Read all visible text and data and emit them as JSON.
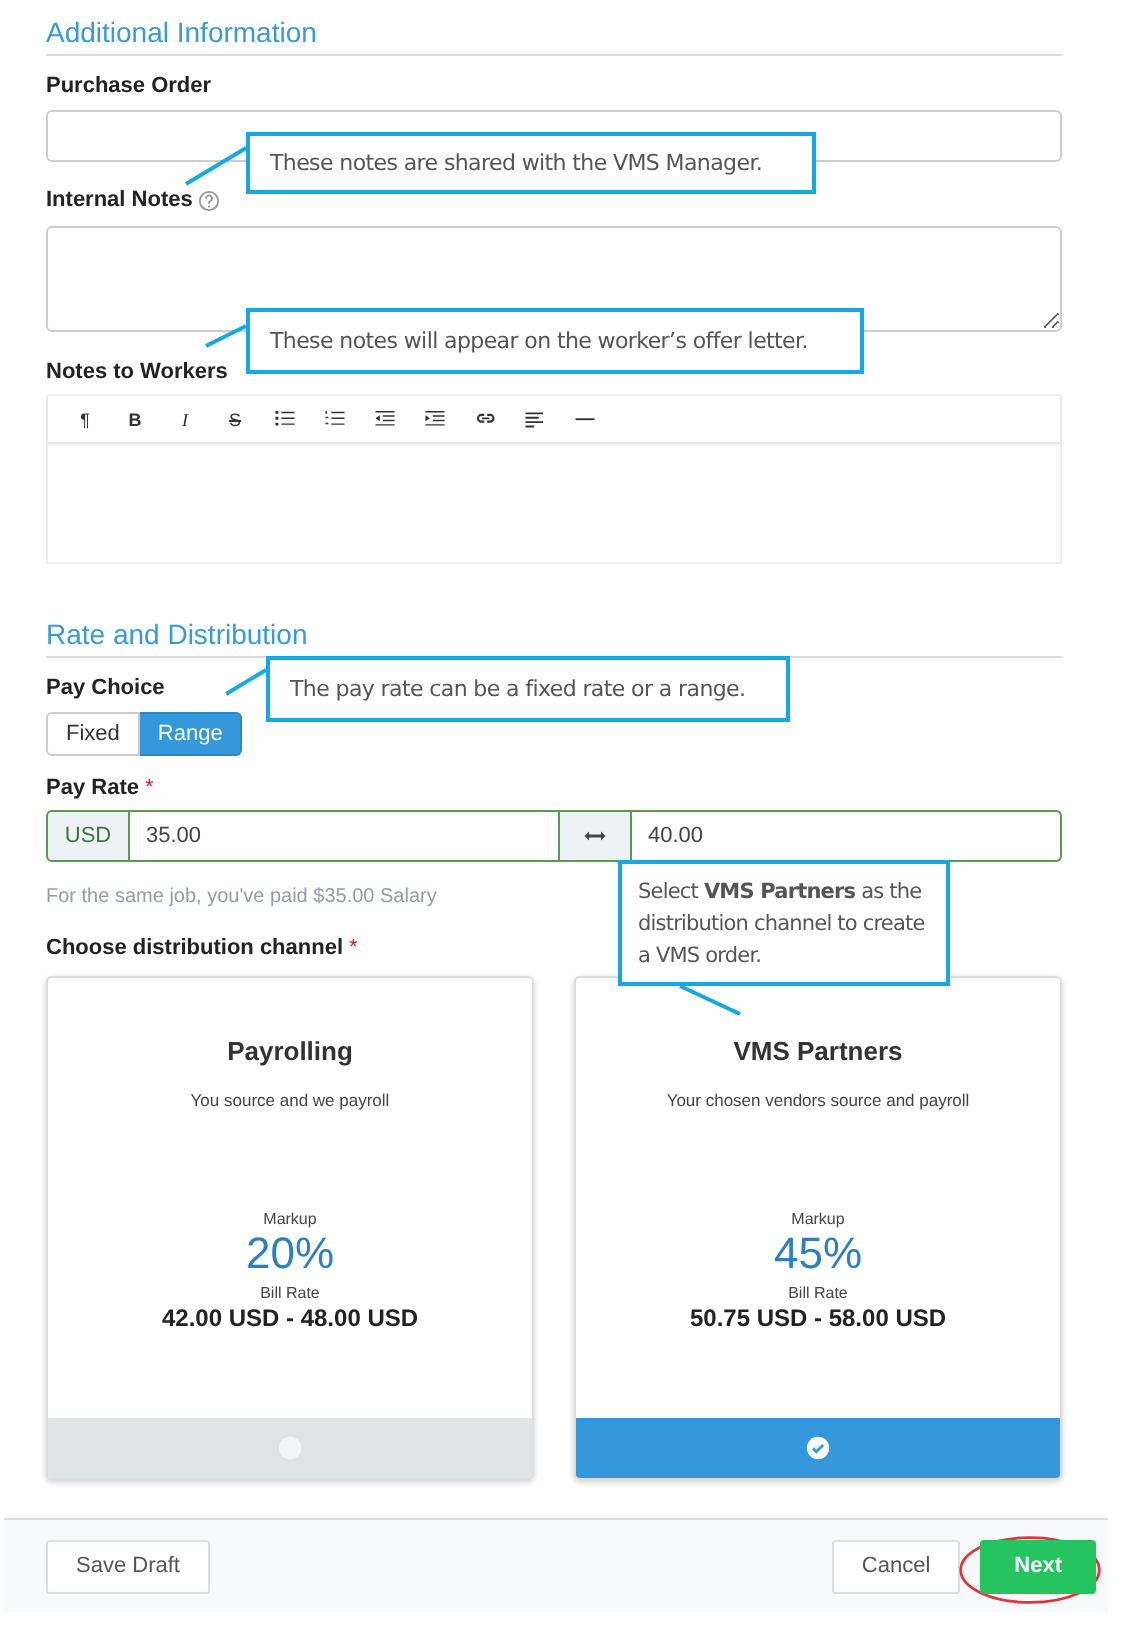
{
  "additional": {
    "heading": "Additional Information",
    "purchase_order": {
      "label": "Purchase Order"
    },
    "internal_notes": {
      "label": "Internal Notes",
      "help_icon": true
    },
    "notes_to_workers": {
      "label": "Notes to Workers",
      "toolbar": [
        {
          "kind": "glyph",
          "label": "¶"
        },
        {
          "kind": "bold",
          "label": "B"
        },
        {
          "kind": "italic",
          "label": "I"
        },
        {
          "kind": "strike",
          "label": "S"
        },
        {
          "kind": "bullet-list"
        },
        {
          "kind": "numbered-list"
        },
        {
          "kind": "outdent"
        },
        {
          "kind": "indent"
        },
        {
          "kind": "link"
        },
        {
          "kind": "align-left"
        },
        {
          "kind": "horizontal-rule"
        }
      ]
    }
  },
  "rate": {
    "heading": "Rate and Distribution",
    "pay_choice": {
      "label": "Pay Choice",
      "options": [
        {
          "label": "Fixed",
          "selected": false
        },
        {
          "label": "Range",
          "selected": true
        }
      ]
    },
    "pay_rate": {
      "label": "Pay Rate",
      "required_mark": "*",
      "currency": "USD",
      "min": "35.00",
      "max": "40.00"
    },
    "hint": "For the same job, you've paid $35.00 Salary",
    "channel": {
      "label": "Choose distribution channel",
      "required_mark": "*",
      "options": [
        {
          "title": "Payrolling",
          "subtitle": "You source and we payroll",
          "markup_label": "Markup",
          "markup": "20%",
          "bill_label": "Bill Rate",
          "bill_rate": "42.00 USD - 48.00 USD",
          "selected": false
        },
        {
          "title": "VMS Partners",
          "subtitle": "Your chosen vendors source and payroll",
          "markup_label": "Markup",
          "markup": "45%",
          "bill_label": "Bill Rate",
          "bill_rate": "50.75 USD - 58.00 USD",
          "selected": true
        }
      ]
    }
  },
  "footer": {
    "save_draft": "Save Draft",
    "cancel": "Cancel",
    "next": "Next",
    "next_highlighted": true
  },
  "callouts": [
    {
      "text": "These notes are shared with the VMS Manager."
    },
    {
      "text": "These notes will appear on the worker’s offer letter."
    },
    {
      "text": "The pay rate can be a fixed rate or a range."
    },
    {
      "text": "Select **VMS Partners** as the distribution channel to create a VMS order."
    }
  ]
}
